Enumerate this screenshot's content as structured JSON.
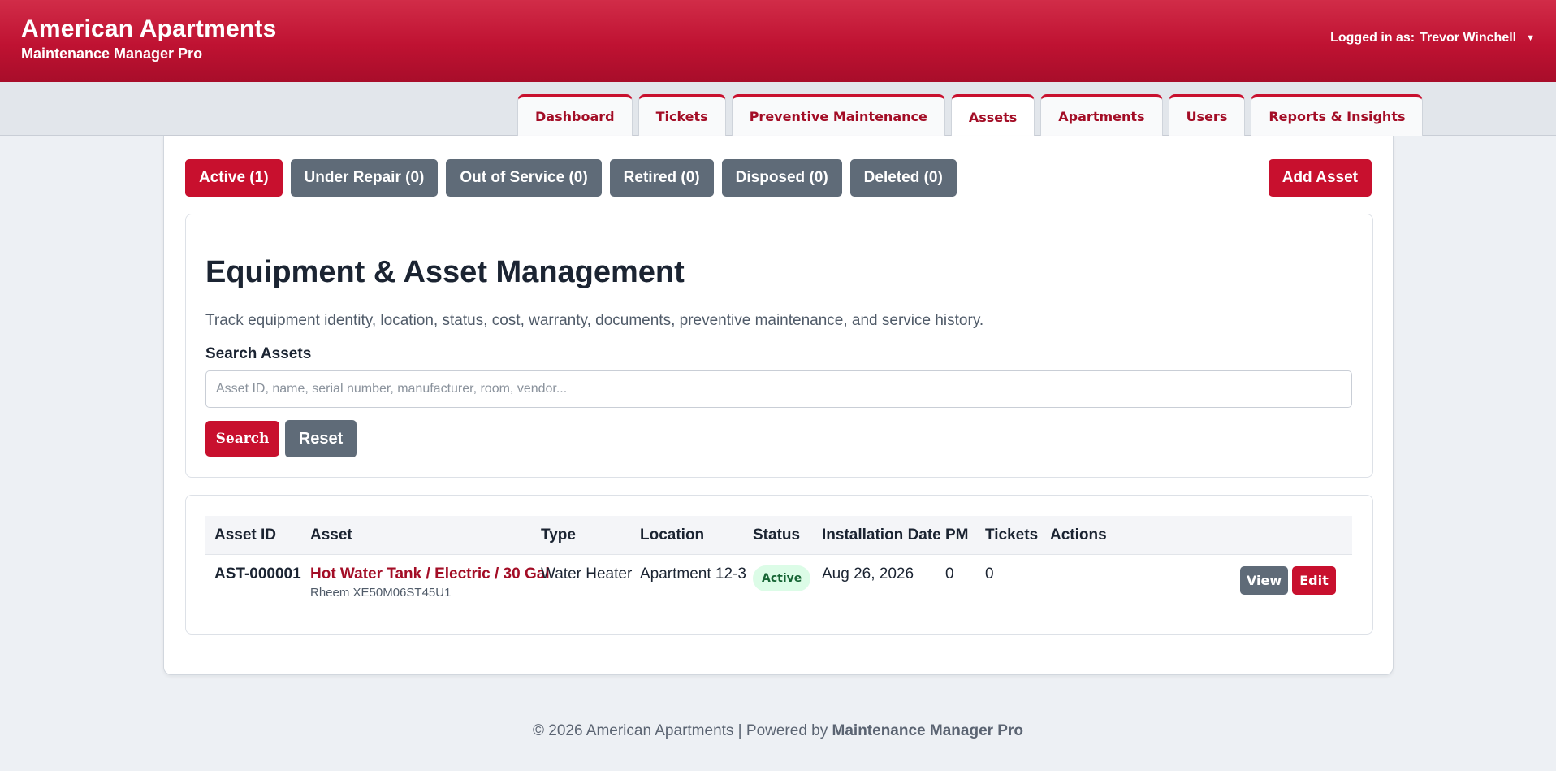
{
  "header": {
    "title": "American Apartments",
    "subtitle": "Maintenance Manager Pro",
    "user_prefix": "Logged in as:",
    "user_name": "Trevor Winchell",
    "user_caret": "▼"
  },
  "nav": {
    "tabs": [
      {
        "label": "Dashboard"
      },
      {
        "label": "Tickets"
      },
      {
        "label": "Preventive Maintenance"
      },
      {
        "label": "Assets"
      },
      {
        "label": "Apartments"
      },
      {
        "label": "Users"
      },
      {
        "label": "Reports & Insights"
      }
    ],
    "active": "Assets"
  },
  "filters": [
    {
      "label": "Active (1)",
      "active": true
    },
    {
      "label": "Under Repair (0)"
    },
    {
      "label": "Out of Service (0)"
    },
    {
      "label": "Retired (0)"
    },
    {
      "label": "Disposed (0)"
    },
    {
      "label": "Deleted (0)"
    }
  ],
  "add_button": "Add Asset",
  "search_card": {
    "title": "Equipment & Asset Management",
    "description": "Track equipment identity, location, status, cost, warranty, documents, preventive maintenance, and service history.",
    "label": "Search Assets",
    "placeholder": "Asset ID, name, serial number, manufacturer, room, vendor...",
    "value": "",
    "search_button": "Search",
    "reset_button": "Reset"
  },
  "table": {
    "columns": [
      "Asset ID",
      "Asset",
      "Type",
      "Location",
      "Status",
      "Installation Date",
      "PM",
      "Tickets",
      "Actions"
    ],
    "rows": [
      {
        "asset_id": "AST-000001",
        "asset_name": "Hot Water Tank / Electric / 30 Gal",
        "asset_model": "Rheem XE50M06ST45U1",
        "type": "Water Heater",
        "location": "Apartment 12-3",
        "status": "Active",
        "installation_date": "Aug 26, 2026",
        "pm": "0",
        "tickets": "0",
        "view_label": "View",
        "edit_label": "Edit"
      }
    ]
  },
  "footer": {
    "prefix": "© 2026 American Apartments | Powered by",
    "brand": "Maintenance Manager Pro"
  },
  "colors": {
    "accent": "#c8102e",
    "secondary_button": "#5f6b78",
    "status_active_bg": "#dcfce7",
    "status_active_text": "#166534"
  }
}
